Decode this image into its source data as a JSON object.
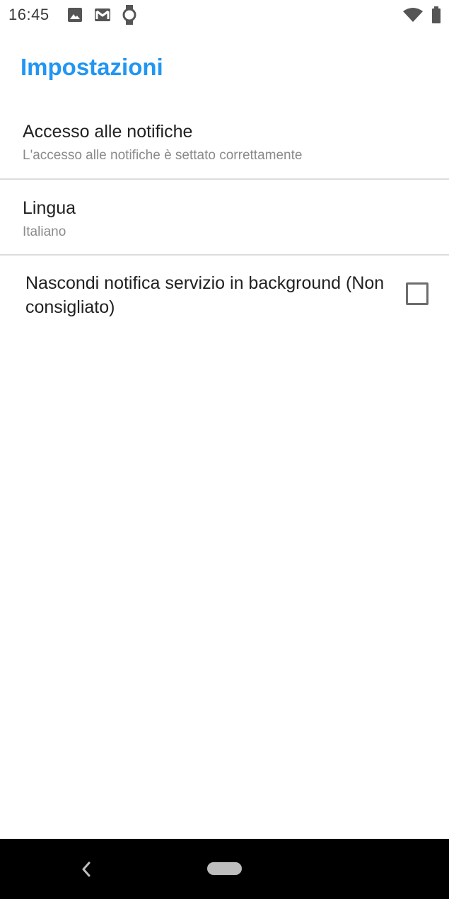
{
  "status_bar": {
    "time": "16:45",
    "icons_left": [
      "image-icon",
      "gmail-icon",
      "watch-icon"
    ],
    "icons_right": [
      "wifi-icon",
      "battery-icon"
    ]
  },
  "app_bar": {
    "title": "Impostazioni",
    "title_color": "#2196f3"
  },
  "preferences": [
    {
      "title": "Accesso alle notifiche",
      "summary": "L'accesso alle notifiche è settato correttamente"
    },
    {
      "title": "Lingua",
      "summary": "Italiano"
    }
  ],
  "checkbox_pref": {
    "title": "Nascondi notifica servizio in background (Non consigliato)",
    "checked": false
  },
  "nav_bar": {
    "buttons": [
      "back-icon",
      "home-pill"
    ]
  }
}
